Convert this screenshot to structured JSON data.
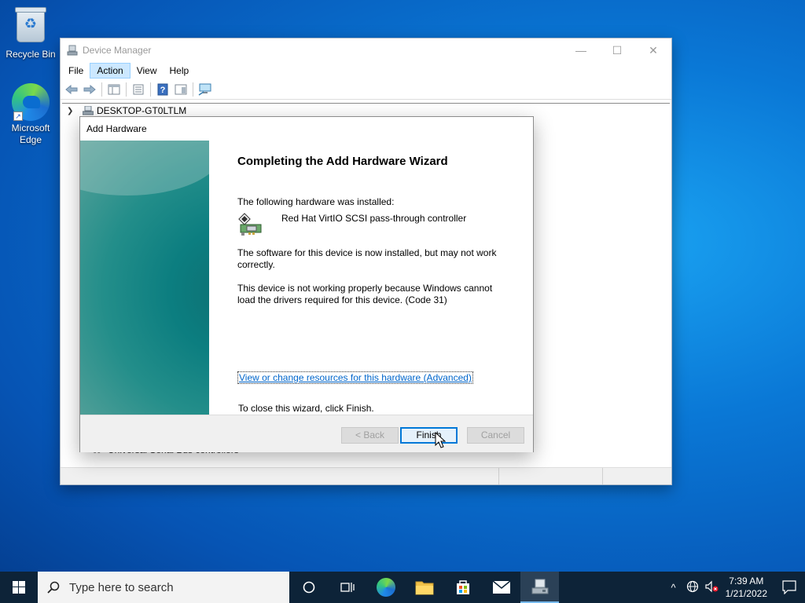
{
  "desktop": {
    "icons": [
      {
        "label": "Recycle Bin"
      },
      {
        "label": "Microsoft Edge"
      }
    ]
  },
  "device_manager": {
    "title": "Device Manager",
    "menu": [
      "File",
      "Action",
      "View",
      "Help"
    ],
    "active_menu": "Action",
    "tree_root": "DESKTOP-GT0LTLM",
    "partial_tree_item": "Universal Serial Bus controllers"
  },
  "dialog": {
    "title": "Add Hardware",
    "heading": "Completing the Add Hardware Wizard",
    "installed_label": "The following hardware was installed:",
    "device_name": "Red Hat VirtIO SCSI pass-through controller",
    "software_text": "The software for this device is now installed, but may not work correctly.",
    "error_text": "This device is not working properly because Windows cannot load the drivers required for this device. (Code 31)",
    "advanced_link": "View or change resources for this hardware (Advanced)",
    "close_hint": "To close this wizard, click Finish.",
    "buttons": {
      "back": "< Back",
      "finish": "Finish",
      "cancel": "Cancel"
    }
  },
  "taskbar": {
    "search_placeholder": "Type here to search",
    "time": "7:39 AM",
    "date": "1/21/2022",
    "apps": [
      "task-view-icon",
      "edge-icon",
      "file-explorer-icon",
      "store-icon",
      "mail-icon",
      "device-manager-icon"
    ]
  },
  "colors": {
    "accent": "#0078d7",
    "link": "#0066cc",
    "taskbar": "#0d2338"
  }
}
